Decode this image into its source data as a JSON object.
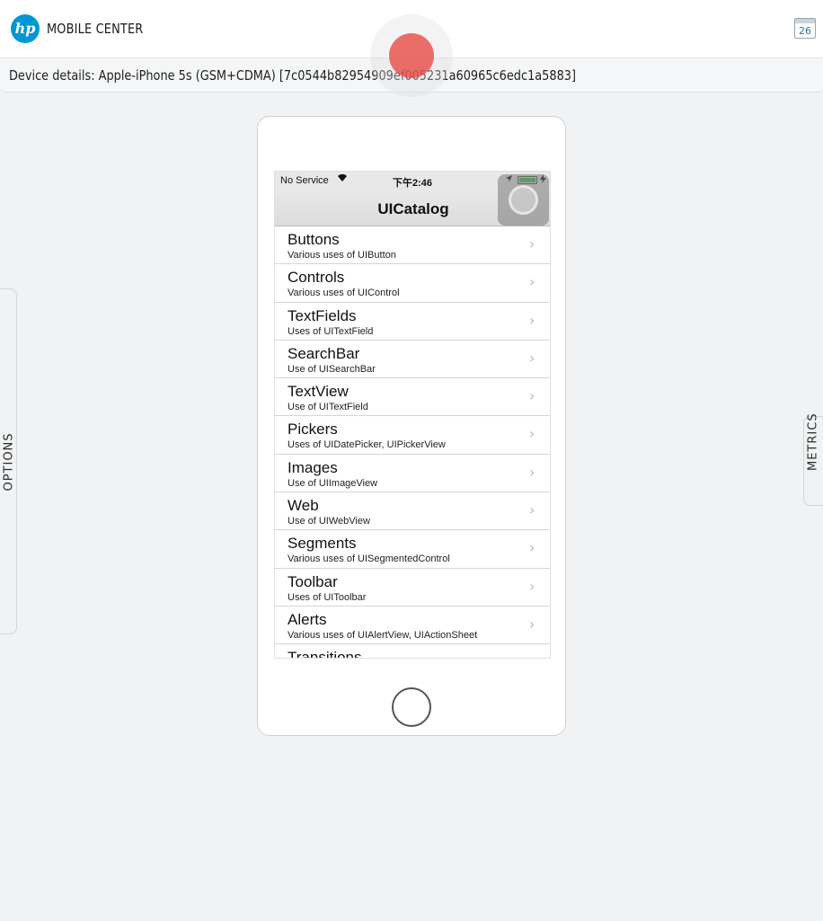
{
  "header": {
    "logo_text": "hp",
    "app_title": "MOBILE CENTER",
    "calendar_day": "26"
  },
  "details": {
    "text": "Device details: Apple-iPhone 5s (GSM+CDMA) [7c0544b82954909ef005231a60965c6edc1a5883]"
  },
  "side_panels": {
    "left": "OPTIONS",
    "right": "METRICS"
  },
  "device": {
    "status": {
      "carrier": "No Service",
      "wifi_icon": "⩖",
      "time": "下午2:46"
    },
    "nav_title": "UICatalog",
    "items": [
      {
        "title": "Buttons",
        "subtitle": "Various uses of UIButton"
      },
      {
        "title": "Controls",
        "subtitle": "Various uses of UIControl"
      },
      {
        "title": "TextFields",
        "subtitle": "Uses of UITextField"
      },
      {
        "title": "SearchBar",
        "subtitle": "Use of UISearchBar"
      },
      {
        "title": "TextView",
        "subtitle": "Use of UITextField"
      },
      {
        "title": "Pickers",
        "subtitle": "Uses of UIDatePicker, UIPickerView"
      },
      {
        "title": "Images",
        "subtitle": "Use of UIImageView"
      },
      {
        "title": "Web",
        "subtitle": "Use of UIWebView"
      },
      {
        "title": "Segments",
        "subtitle": "Various uses of UISegmentedControl"
      },
      {
        "title": "Toolbar",
        "subtitle": "Uses of UIToolbar"
      },
      {
        "title": "Alerts",
        "subtitle": "Various uses of UIAlertView, UIActionSheet"
      },
      {
        "title": "Transitions",
        "subtitle": ""
      }
    ],
    "chevron": "›"
  },
  "colors": {
    "hp_blue": "#0096d6",
    "record_red": "#e84642",
    "battery_green": "#3cc24a"
  },
  "icons": [
    "hp-logo-icon",
    "calendar-icon",
    "record-icon",
    "wifi-icon",
    "location-icon",
    "battery-icon",
    "charging-icon",
    "chevron-right-icon",
    "home-button-icon",
    "assistive-touch-icon"
  ]
}
